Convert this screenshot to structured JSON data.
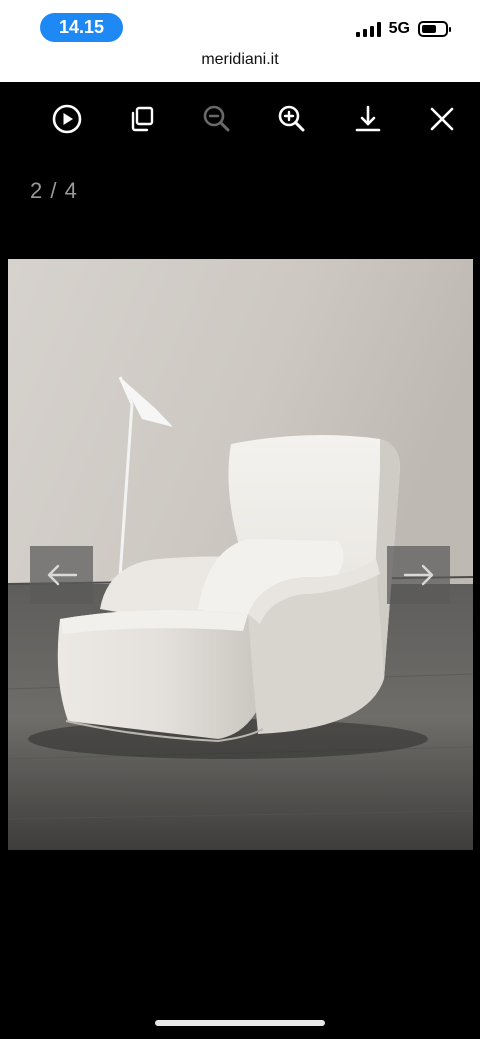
{
  "status_bar": {
    "time": "14.15",
    "network": "5G",
    "battery_level": 0.65
  },
  "browser": {
    "url": "meridiani.it"
  },
  "viewer": {
    "toolbar": [
      {
        "name": "play-slideshow-button",
        "icon": "play-circle-icon"
      },
      {
        "name": "copy-button",
        "icon": "copy-icon"
      },
      {
        "name": "zoom-out-button",
        "icon": "zoom-out-icon",
        "disabled": true
      },
      {
        "name": "zoom-in-button",
        "icon": "zoom-in-icon"
      },
      {
        "name": "download-button",
        "icon": "download-icon"
      },
      {
        "name": "close-button",
        "icon": "close-icon"
      }
    ],
    "counter": "2 / 4",
    "current_index": 2,
    "total": 4,
    "photo_subject": "white armchair with floor lamp"
  },
  "colors": {
    "accent": "#1e88f5",
    "toolbar_icon": "#ffffff",
    "toolbar_icon_disabled": "#6a6a6a",
    "nav_arrow_bg": "#5a5a5a"
  }
}
